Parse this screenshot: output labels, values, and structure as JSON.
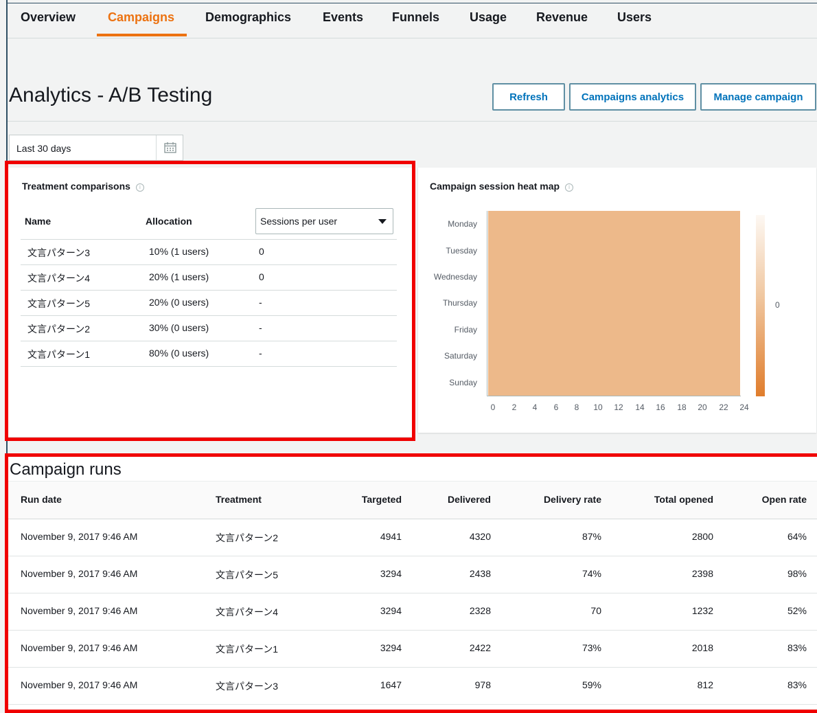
{
  "tabs": [
    "Overview",
    "Campaigns",
    "Demographics",
    "Events",
    "Funnels",
    "Usage",
    "Revenue",
    "Users"
  ],
  "active_tab": "Campaigns",
  "page_title": "Analytics - A/B Testing",
  "buttons": {
    "refresh": "Refresh",
    "campaigns_analytics": "Campaigns analytics",
    "manage_campaign": "Manage campaign"
  },
  "date_range": "Last 30 days",
  "treatment": {
    "title": "Treatment comparisons",
    "columns": {
      "name": "Name",
      "allocation": "Allocation"
    },
    "metric_select": "Sessions per user",
    "rows": [
      {
        "name": "文言パターン3",
        "allocation": "10% (1 users)",
        "value": "0"
      },
      {
        "name": "文言パターン4",
        "allocation": "20% (1 users)",
        "value": "0"
      },
      {
        "name": "文言パターン5",
        "allocation": "20% (0 users)",
        "value": "-"
      },
      {
        "name": "文言パターン2",
        "allocation": "30% (0 users)",
        "value": "-"
      },
      {
        "name": "文言パターン1",
        "allocation": "80% (0 users)",
        "value": "-"
      }
    ]
  },
  "heatmap": {
    "title": "Campaign session heat map",
    "days": [
      "Monday",
      "Tuesday",
      "Wednesday",
      "Thursday",
      "Friday",
      "Saturday",
      "Sunday"
    ],
    "hours": [
      "0",
      "2",
      "4",
      "6",
      "8",
      "10",
      "12",
      "14",
      "16",
      "18",
      "20",
      "22",
      "24"
    ],
    "legend_value": "0",
    "cell_color": "#edb98a"
  },
  "runs": {
    "title": "Campaign runs",
    "columns": [
      "Run date",
      "Treatment",
      "Targeted",
      "Delivered",
      "Delivery rate",
      "Total opened",
      "Open rate"
    ],
    "rows": [
      [
        "November 9, 2017 9:46 AM",
        "文言パターン2",
        "4941",
        "4320",
        "87%",
        "2800",
        "64%"
      ],
      [
        "November 9, 2017 9:46 AM",
        "文言パターン5",
        "3294",
        "2438",
        "74%",
        "2398",
        "98%"
      ],
      [
        "November 9, 2017 9:46 AM",
        "文言パターン4",
        "3294",
        "2328",
        "70",
        "1232",
        "52%"
      ],
      [
        "November 9, 2017 9:46 AM",
        "文言パターン1",
        "3294",
        "2422",
        "73%",
        "2018",
        "83%"
      ],
      [
        "November 9, 2017 9:46 AM",
        "文言パターン3",
        "1647",
        "978",
        "59%",
        "812",
        "83%"
      ]
    ]
  },
  "colors": {
    "accent": "#ec7211",
    "link": "#0073bb",
    "highlight": "#f00000"
  }
}
